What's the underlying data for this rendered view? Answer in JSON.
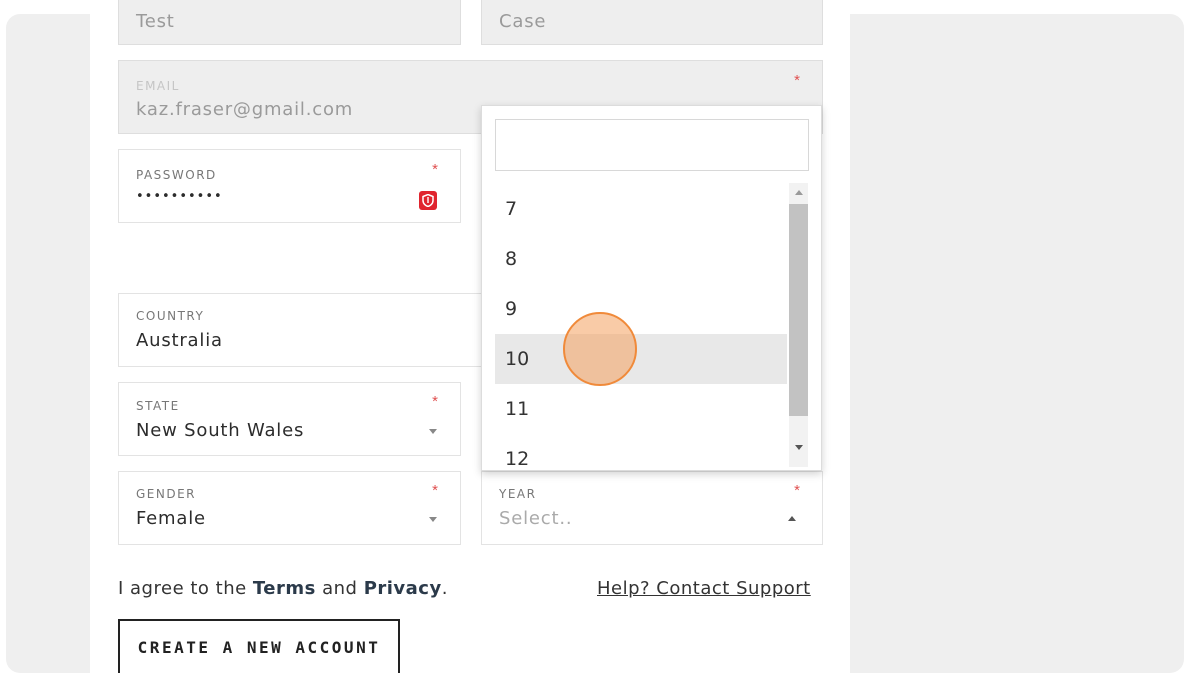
{
  "form": {
    "first_name": {
      "value": "Test"
    },
    "last_name": {
      "value": "Case"
    },
    "email": {
      "label": "EMAIL",
      "value": "kaz.fraser@gmail.com",
      "required": "*"
    },
    "password": {
      "label": "PASSWORD",
      "value": "••••••••••",
      "required": "*"
    },
    "country": {
      "label": "COUNTRY",
      "value": "Australia"
    },
    "state": {
      "label": "STATE",
      "value": "New South Wales",
      "required": "*"
    },
    "gender": {
      "label": "GENDER",
      "value": "Female",
      "required": "*"
    },
    "year": {
      "label": "YEAR",
      "placeholder": "Select..",
      "required": "*"
    }
  },
  "dropdown": {
    "search_value": "",
    "options": [
      "7",
      "8",
      "9",
      "10",
      "11",
      "12"
    ],
    "hovered": "10"
  },
  "footer": {
    "agree_prefix": "I agree to the ",
    "terms": "Terms",
    "and": " and ",
    "privacy": "Privacy",
    "period": ".",
    "help": "Help? Contact Support",
    "create_button": "CREATE A NEW ACCOUNT"
  },
  "colors": {
    "required": "#e05050",
    "password_icon": "#e0242e",
    "cursor": "#f08a3a"
  },
  "icons": {
    "password_manager": "shield-icon"
  }
}
